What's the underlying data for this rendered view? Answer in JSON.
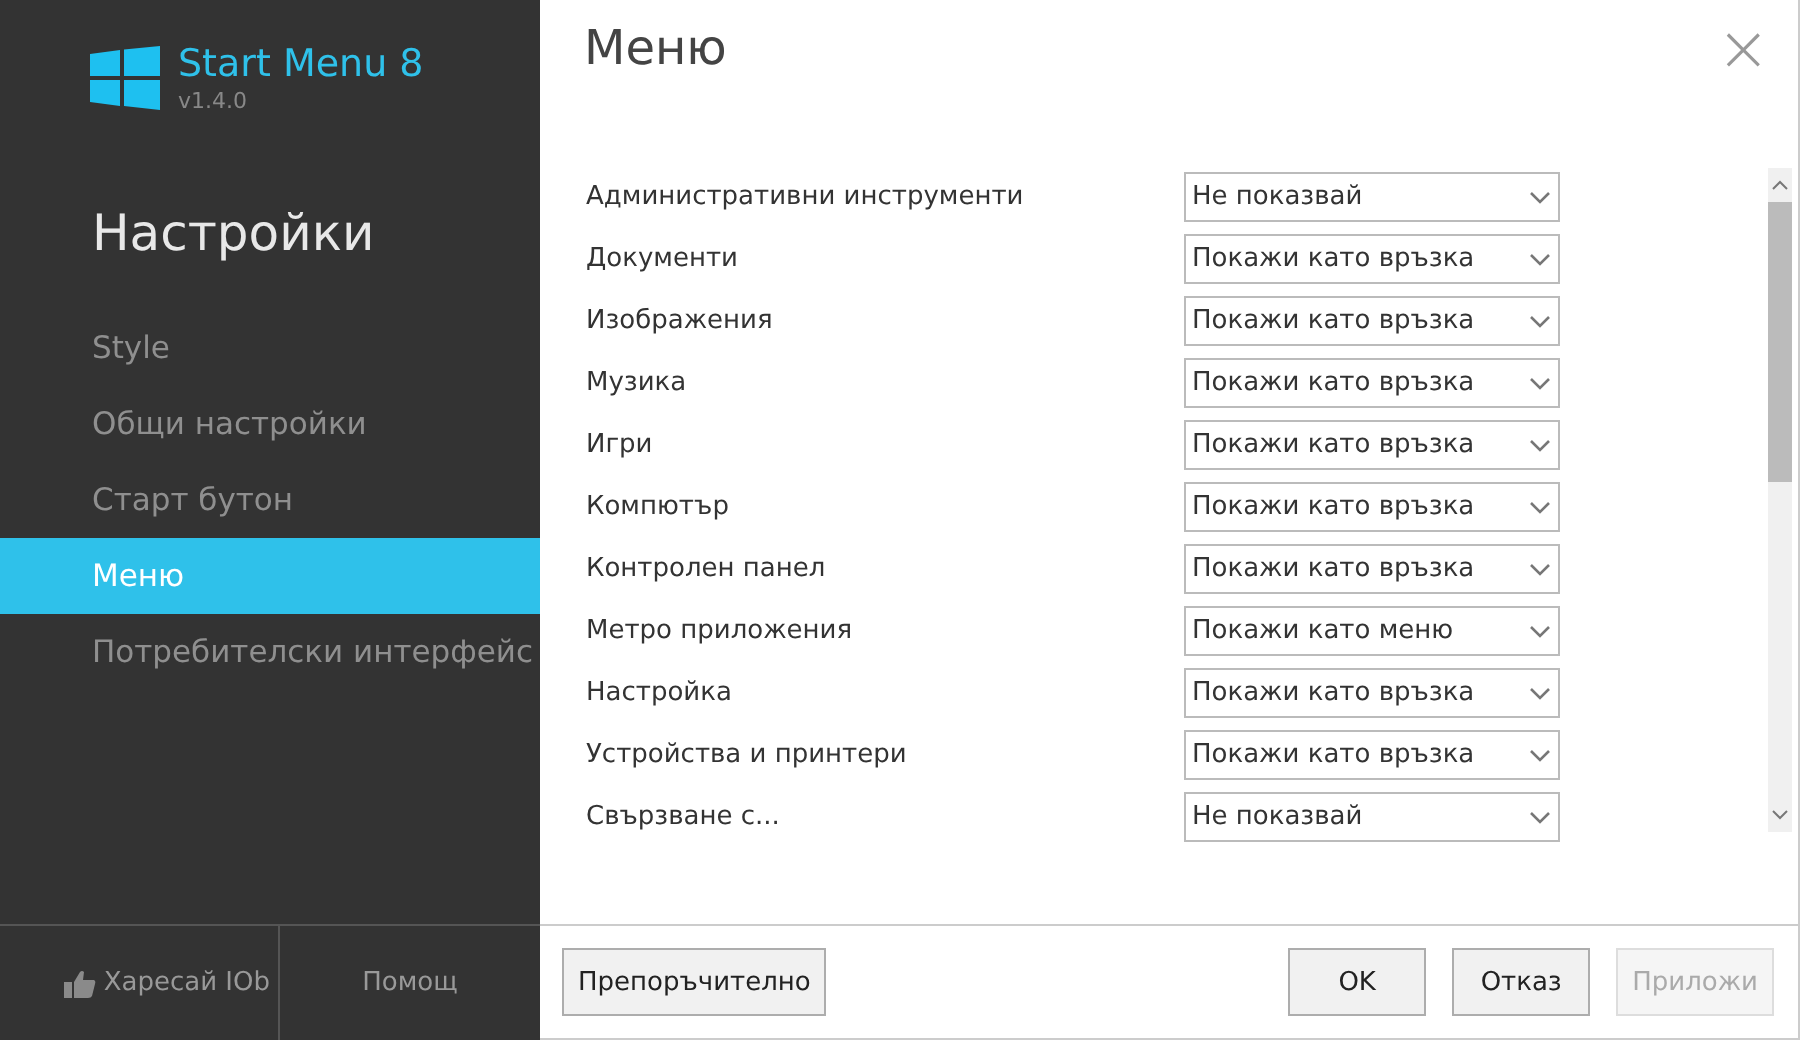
{
  "app": {
    "name": "Start Menu 8",
    "version": "v1.4.0"
  },
  "sidebar": {
    "heading": "Настройки",
    "items": [
      {
        "label": "Style",
        "selected": false
      },
      {
        "label": "Общи настройки",
        "selected": false
      },
      {
        "label": "Старт бутон",
        "selected": false
      },
      {
        "label": "Меню",
        "selected": true
      },
      {
        "label": "Потребителски интерфейс",
        "selected": false
      }
    ],
    "like_button": "Харесай IOb",
    "help_button": "Помощ"
  },
  "page": {
    "title": "Меню",
    "close": "×"
  },
  "settings": [
    {
      "label": "Административни инструменти",
      "value": "Не показвай"
    },
    {
      "label": "Документи",
      "value": "Покажи като връзка"
    },
    {
      "label": "Изображения",
      "value": "Покажи като връзка"
    },
    {
      "label": "Музика",
      "value": "Покажи като връзка"
    },
    {
      "label": "Игри",
      "value": "Покажи като връзка"
    },
    {
      "label": "Компютър",
      "value": "Покажи като връзка"
    },
    {
      "label": "Контролен панел",
      "value": "Покажи като връзка"
    },
    {
      "label": "Метро приложения",
      "value": "Покажи като меню"
    },
    {
      "label": "Настройка",
      "value": "Покажи като връзка"
    },
    {
      "label": "Устройства и принтери",
      "value": "Покажи като връзка"
    },
    {
      "label": "Свързване с...",
      "value": "Не показвай"
    }
  ],
  "footer": {
    "recommended": "Препоръчително",
    "buttons": [
      {
        "label": "OK",
        "disabled": false
      },
      {
        "label": "Отказ",
        "disabled": false
      },
      {
        "label": "Приложи",
        "disabled": true
      }
    ]
  }
}
